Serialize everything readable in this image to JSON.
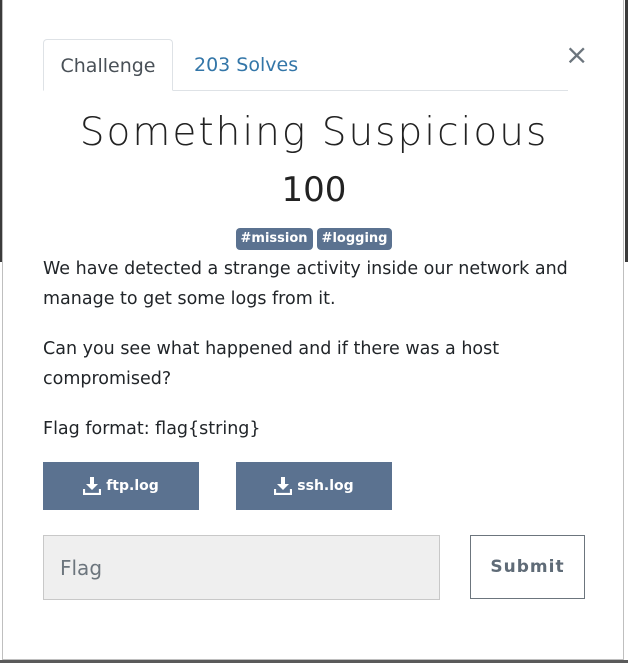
{
  "tabs": {
    "challenge_label": "Challenge",
    "solves_label": "203 Solves"
  },
  "close_label": "×",
  "challenge": {
    "name": "Something Suspicious",
    "value": "100",
    "tags": [
      "#mission",
      "#logging"
    ],
    "description": [
      "We have detected a strange activity inside our network and manage to get some logs from it.",
      "Can you see what happened and if there was a host compromised?",
      "Flag format: flag{string}"
    ]
  },
  "files": [
    {
      "label": "ftp.log",
      "icon": "download-icon"
    },
    {
      "label": "ssh.log",
      "icon": "download-icon"
    }
  ],
  "form": {
    "flag_placeholder": "Flag",
    "submit_label": "Submit"
  },
  "colors": {
    "tag_bg": "#5b7290",
    "button_bg": "#5b7290",
    "link": "#3376a8"
  }
}
